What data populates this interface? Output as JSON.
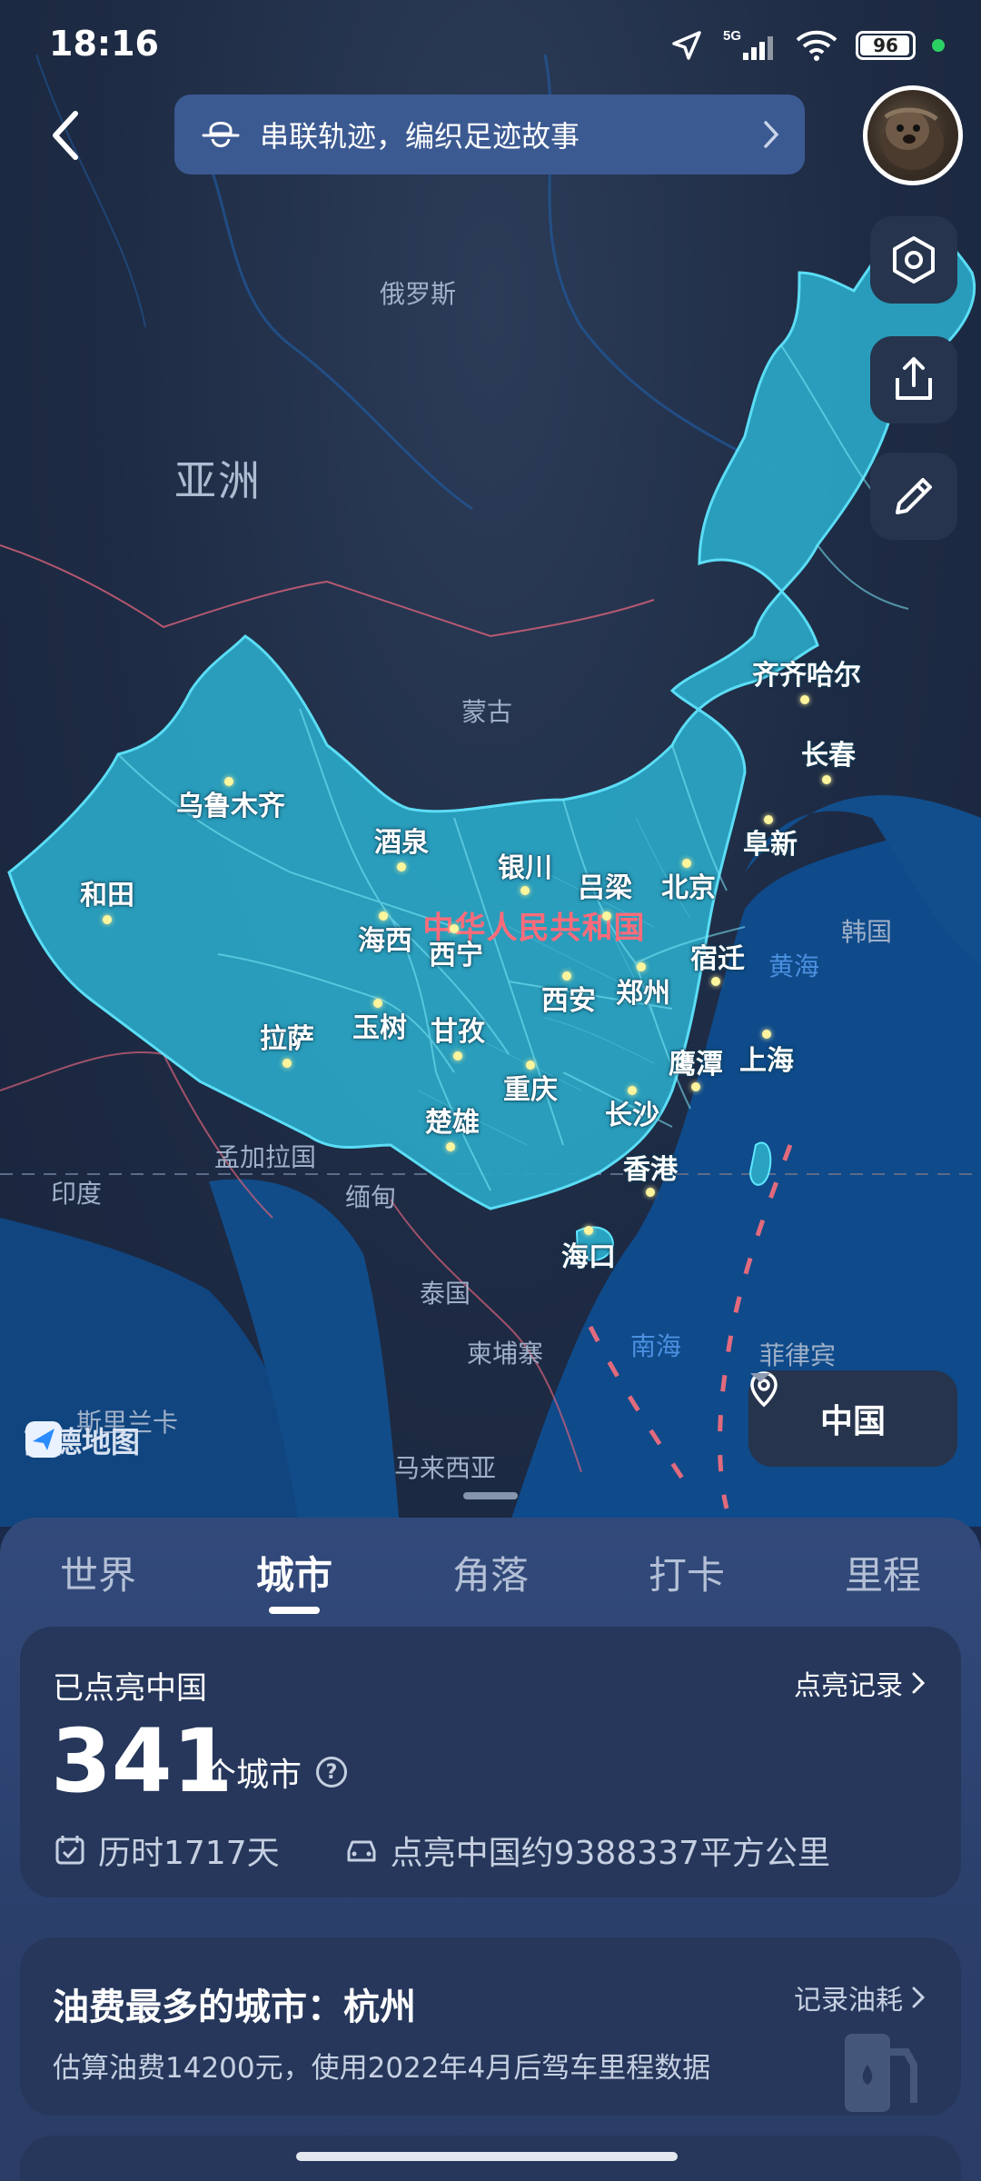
{
  "status_bar": {
    "time": "18:16",
    "network": "5G",
    "battery": "96"
  },
  "header": {
    "banner_text": "串联轨迹，编织足迹故事"
  },
  "map": {
    "regions": {
      "russia": "俄罗斯",
      "asia": "亚洲",
      "mongolia": "蒙古",
      "china": "中华人民共和国",
      "korea": "韩国",
      "yellow_sea": "黄海",
      "bangladesh": "孟加拉国",
      "india": "印度",
      "myanmar": "缅甸",
      "thailand": "泰国",
      "cambodia": "柬埔寨",
      "south_sea": "南海",
      "philippines": "菲律宾",
      "malaysia": "马来西亚",
      "sri_lanka": "斯里兰卡"
    },
    "cities": {
      "qiqihar": "齐齐哈尔",
      "changchun": "长春",
      "urumqi": "乌鲁木齐",
      "jiuquan": "酒泉",
      "yinchuan": "银川",
      "lvliang": "吕梁",
      "beijing": "北京",
      "fuxin": "阜新",
      "hotan": "和田",
      "haixi": "海西",
      "xining": "西宁",
      "suqian": "宿迁",
      "xian": "西安",
      "zhengzhou": "郑州",
      "lhasa": "拉萨",
      "yushu": "玉树",
      "ganzi": "甘孜",
      "yingtan": "鹰潭",
      "shanghai": "上海",
      "chongqing": "重庆",
      "changsha": "长沙",
      "chuxiong": "楚雄",
      "hongkong": "香港",
      "haikou": "海口"
    },
    "logo_text": "高德地图",
    "region_selector": "中国"
  },
  "tabs": [
    "世界",
    "城市",
    "角落",
    "打卡",
    "里程"
  ],
  "active_tab": "城市",
  "lit_card": {
    "title": "已点亮中国",
    "link": "点亮记录",
    "count": "341",
    "unit": "个城市",
    "days_text": "历时1717天",
    "area_text": "点亮中国约9388337平方公里"
  },
  "fuel_card": {
    "title": "油费最多的城市：杭州",
    "link": "记录油耗",
    "subtitle": "估算油费14200元，使用2022年4月后驾车里程数据"
  },
  "colors": {
    "china_fill": "#2aa3c2",
    "china_border": "#5fe7ff",
    "map_bg": "#1e2b44",
    "sea": "#0f4a8a",
    "banner": "#3c5a92",
    "sheet": "#2b3f6b",
    "card": "#26375b"
  }
}
